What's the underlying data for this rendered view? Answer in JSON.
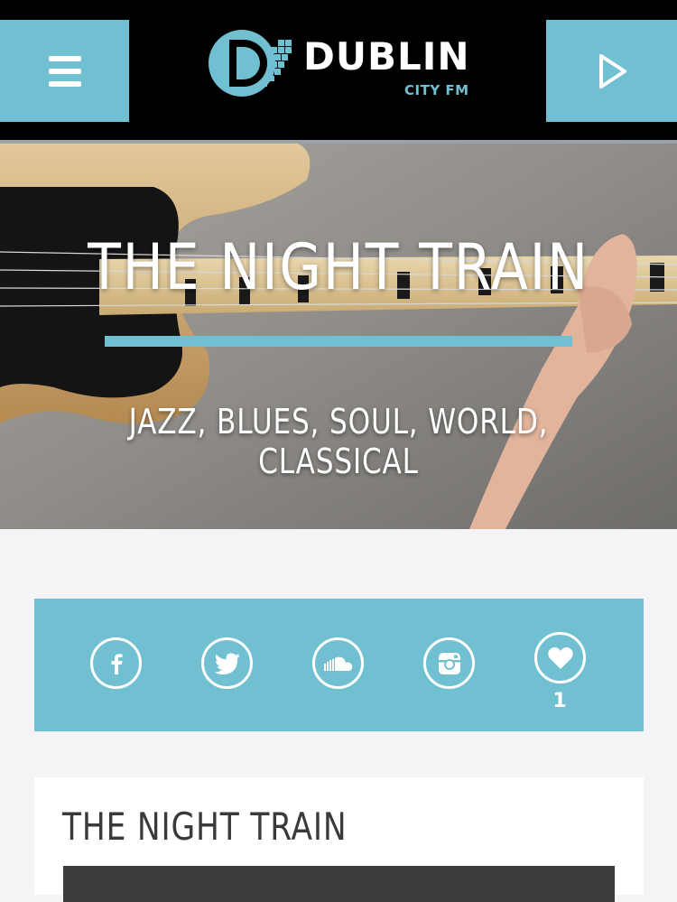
{
  "colors": {
    "accent": "#71c0d2",
    "header_bg": "#000000",
    "page_bg": "#f4f4f6"
  },
  "header": {
    "menu_icon": "hamburger-menu-icon",
    "play_icon": "play-icon",
    "logo": {
      "name": "DUBLIN",
      "tagline": "CITY FM"
    }
  },
  "hero": {
    "title": "THE NIGHT TRAIN",
    "genres": "JAZZ, BLUES, SOUL, WORLD, CLASSICAL"
  },
  "social": {
    "icons": [
      "facebook-icon",
      "twitter-icon",
      "soundcloud-icon",
      "instagram-icon",
      "heart-icon"
    ],
    "like_count": "1"
  },
  "content": {
    "title": "THE NIGHT TRAIN"
  }
}
